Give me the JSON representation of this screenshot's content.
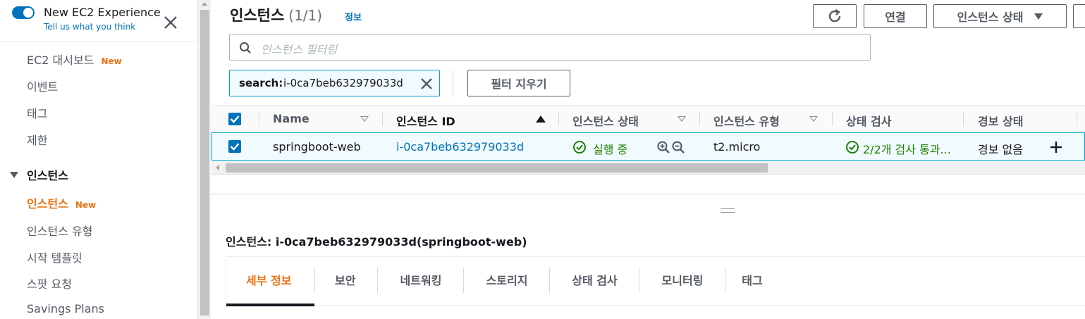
{
  "sidebar": {
    "experience_label": "New EC2 Experience",
    "tell_us": "Tell us what you think",
    "items": [
      {
        "label": "EC2 대시보드",
        "badge": "New"
      },
      {
        "label": "이벤트"
      },
      {
        "label": "태그"
      },
      {
        "label": "제한"
      }
    ],
    "section": "인스턴스",
    "sub_items": [
      {
        "label": "인스턴스",
        "badge": "New"
      },
      {
        "label": "인스턴스 유형"
      },
      {
        "label": "시작 템플릿"
      },
      {
        "label": "스팟 요청"
      },
      {
        "label": "Savings Plans"
      }
    ]
  },
  "header": {
    "title": "인스턴스",
    "count": "(1/1)",
    "info": "정보",
    "connect": "연결",
    "instance_state": "인스턴스 상태"
  },
  "filter": {
    "placeholder": "인스턴스 필터링",
    "token_key": "search:",
    "token_value": "i-0ca7beb632979033d",
    "clear": "필터 지우기"
  },
  "table": {
    "columns": [
      "Name",
      "인스턴스 ID",
      "인스턴스 상태",
      "인스턴스 유형",
      "상태 검사",
      "경보 상태"
    ],
    "rows": [
      {
        "name": "springboot-web",
        "instance_id": "i-0ca7beb632979033d",
        "state": "실행 중",
        "type": "t2.micro",
        "status_check": "2/2개 검사 통과...",
        "alarm": "경보 없음"
      }
    ]
  },
  "detail": {
    "prefix": "인스턴스:",
    "value": "i-0ca7beb632979033d(springboot-web)",
    "tabs": [
      "세부 정보",
      "보안",
      "네트워킹",
      "스토리지",
      "상태 검사",
      "모니터링",
      "태그"
    ]
  },
  "colors": {
    "accent": "#ec7211",
    "link": "#0073bb",
    "success": "#1d8102"
  }
}
